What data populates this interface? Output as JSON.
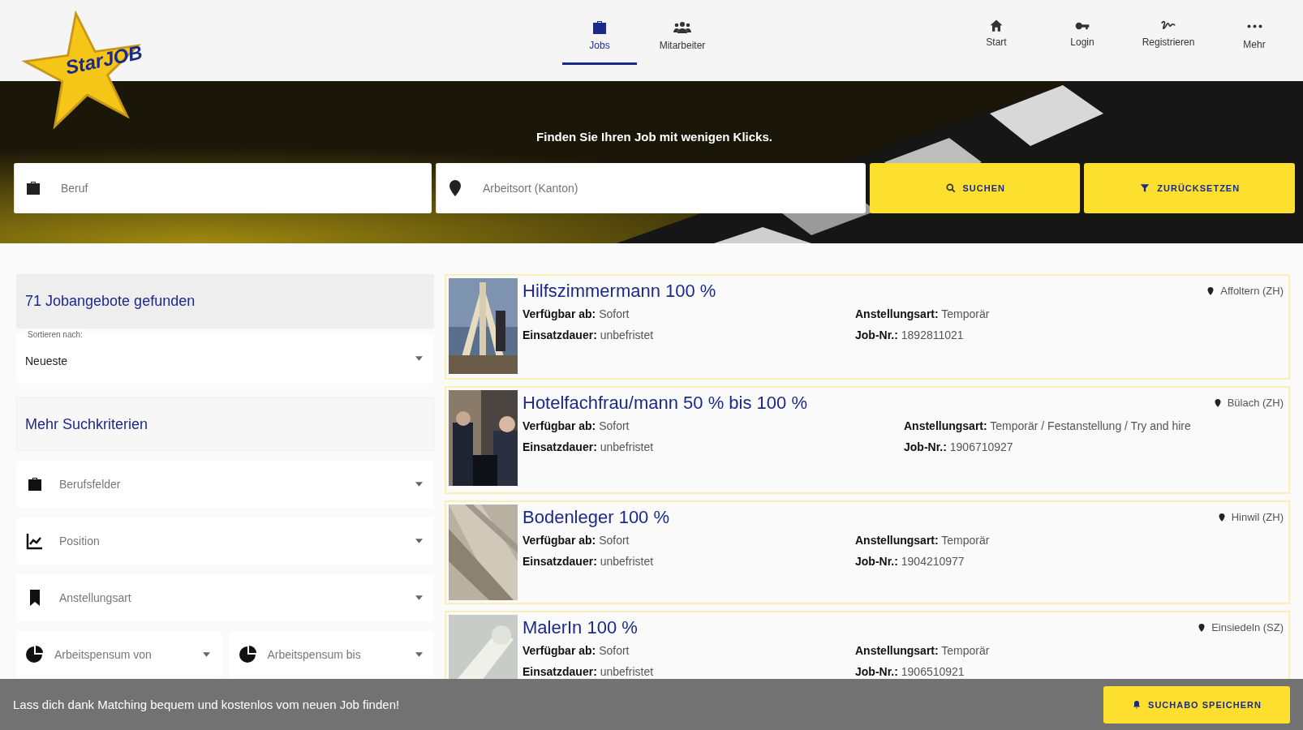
{
  "logo": {
    "text": "StarJOB"
  },
  "nav_center": [
    {
      "label": "Jobs",
      "selected": true
    },
    {
      "label": "Mitarbeiter",
      "selected": false
    }
  ],
  "nav_right": [
    {
      "label": "Start"
    },
    {
      "label": "Login"
    },
    {
      "label": "Registrieren"
    },
    {
      "label": "Mehr"
    }
  ],
  "hero": {
    "tagline": "Finden Sie Ihren Job mit wenigen Klicks.",
    "job_field": {
      "placeholder": "Beruf"
    },
    "location_field": {
      "placeholder": "Arbeitsort (Kanton)"
    },
    "search_button": "SUCHEN",
    "reset_button": "ZURÜCKSETZEN"
  },
  "sidebar": {
    "result_count": "71 Jobangebote gefunden",
    "sort": {
      "label": "Sortieren nach:",
      "value": "Neueste"
    },
    "more_criteria": "Mehr Suchkriterien",
    "filters": [
      {
        "placeholder": "Berufsfelder"
      },
      {
        "placeholder": "Position"
      },
      {
        "placeholder": "Anstellungsart"
      }
    ],
    "workload": [
      {
        "placeholder": "Arbeitspensum von"
      },
      {
        "placeholder": "Arbeitspensum bis"
      }
    ]
  },
  "jobs": [
    {
      "title": "Hilfszimmermann 100 %",
      "location": "Affoltern (ZH)",
      "available": "**Verfügbar ab:** Sofort",
      "duration": "**Einsatzdauer:** unbefristet",
      "type": "**Anstellungsart:** Temporär",
      "job_no": "**Job-Nr.:** 1892811021"
    },
    {
      "title": "Hotelfachfrau/mann 50 % bis 100 %",
      "location": "Bülach (ZH)",
      "available": "**Verfügbar ab:** Sofort",
      "duration": "**Einsatzdauer:** unbefristet",
      "type": "**Anstellungsart:** Temporär / Festanstellung / Try and hire",
      "job_no": "**Job-Nr.:** 1906710927"
    },
    {
      "title": "Bodenleger 100 %",
      "location": "Hinwil (ZH)",
      "available": "**Verfügbar ab:** Sofort",
      "duration": "**Einsatzdauer:** unbefristet",
      "type": "**Anstellungsart:** Temporär",
      "job_no": "**Job-Nr.:** 1904210977"
    },
    {
      "title": "MalerIn 100 %",
      "location": "Einsiedeln (SZ)",
      "available": "**Verfügbar ab:** Sofort",
      "duration": "**Einsatzdauer:** unbefristet",
      "type": "**Anstellungsart:** Temporär",
      "job_no": "**Job-Nr.:** 1906510921"
    }
  ],
  "bottom_bar": {
    "message": "Lass dich dank Matching bequem und kostenlos vom neuen Job finden!",
    "save_button": "SUCHABO SPEICHERN"
  }
}
